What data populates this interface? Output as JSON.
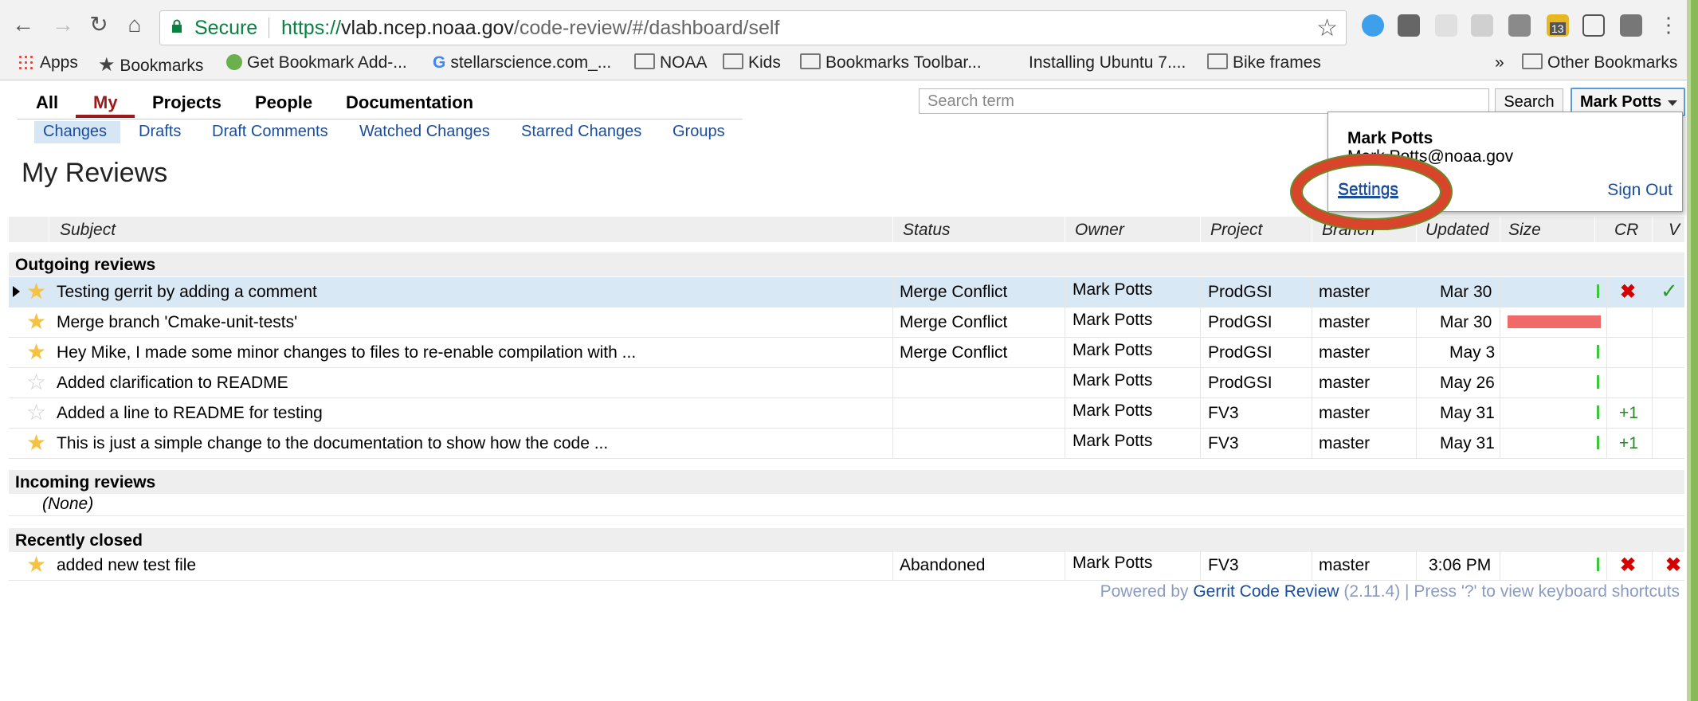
{
  "browser": {
    "secure_label": "Secure",
    "url_scheme": "https://",
    "url_host": "vlab.ncep.noaa.gov",
    "url_path": "/code-review/#/dashboard/self",
    "extension_badge": "13",
    "bookmarks": [
      {
        "label": "Apps"
      },
      {
        "label": "Bookmarks"
      },
      {
        "label": "Get Bookmark Add-..."
      },
      {
        "label": "stellarscience.com_..."
      },
      {
        "label": "NOAA"
      },
      {
        "label": "Kids"
      },
      {
        "label": "Bookmarks Toolbar..."
      },
      {
        "label": "Installing Ubuntu 7...."
      },
      {
        "label": "Bike frames"
      }
    ],
    "overflow": "»",
    "other_bookmarks": "Other Bookmarks"
  },
  "nav": {
    "top": [
      "All",
      "My",
      "Projects",
      "People",
      "Documentation"
    ],
    "sub": [
      "Changes",
      "Drafts",
      "Draft Comments",
      "Watched Changes",
      "Starred Changes",
      "Groups"
    ]
  },
  "search": {
    "placeholder": "Search term",
    "button": "Search"
  },
  "user": {
    "name": "Mark Potts",
    "email": "Mark.Potts@noaa.gov",
    "settings": "Settings",
    "sign_out": "Sign Out"
  },
  "page": {
    "title": "My Reviews"
  },
  "table": {
    "headers": [
      "Subject",
      "Status",
      "Owner",
      "Project",
      "Branch",
      "Updated",
      "Size",
      "CR",
      "V"
    ],
    "sections": {
      "outgoing": "Outgoing reviews",
      "incoming": "Incoming reviews",
      "closed": "Recently closed"
    },
    "none": "(None)",
    "outgoing_rows": [
      {
        "subject": "Testing gerrit by adding a comment",
        "status": "Merge Conflict",
        "owner": "Mark Potts",
        "project": "ProdGSI",
        "branch": "master",
        "updated": "Mar 30",
        "cr": "",
        "v": ""
      },
      {
        "subject": "Merge branch 'Cmake-unit-tests'",
        "status": "Merge Conflict",
        "owner": "Mark Potts",
        "project": "ProdGSI",
        "branch": "master",
        "updated": "Mar 30",
        "cr": "",
        "v": ""
      },
      {
        "subject": "Hey Mike, I made some minor changes to files to re-enable compilation with ...",
        "status": "Merge Conflict",
        "owner": "Mark Potts",
        "project": "ProdGSI",
        "branch": "master",
        "updated": "May 3",
        "cr": "",
        "v": ""
      },
      {
        "subject": "Added clarification to README",
        "status": "",
        "owner": "Mark Potts",
        "project": "ProdGSI",
        "branch": "master",
        "updated": "May 26",
        "cr": "",
        "v": ""
      },
      {
        "subject": "Added a line to README for testing",
        "status": "",
        "owner": "Mark Potts",
        "project": "FV3",
        "branch": "master",
        "updated": "May 31",
        "cr": "+1",
        "v": ""
      },
      {
        "subject": "This is just a simple change to the documentation to show how the code ...",
        "status": "",
        "owner": "Mark Potts",
        "project": "FV3",
        "branch": "master",
        "updated": "May 31",
        "cr": "+1",
        "v": ""
      }
    ],
    "closed_rows": [
      {
        "subject": "added new test file",
        "status": "Abandoned",
        "owner": "Mark Potts",
        "project": "FV3",
        "branch": "master",
        "updated": "3:06 PM",
        "cr": "",
        "v": ""
      }
    ]
  },
  "footer": {
    "prefix": "Powered by ",
    "link": "Gerrit Code Review",
    "suffix": " (2.11.4) | Press '?' to view keyboard shortcuts"
  },
  "colors": {
    "link": "#1a4d9c",
    "active_tab": "#9a1b1b",
    "star": "#f5c242",
    "size_large": "#f06a6a",
    "annotation": "#d8452a"
  }
}
